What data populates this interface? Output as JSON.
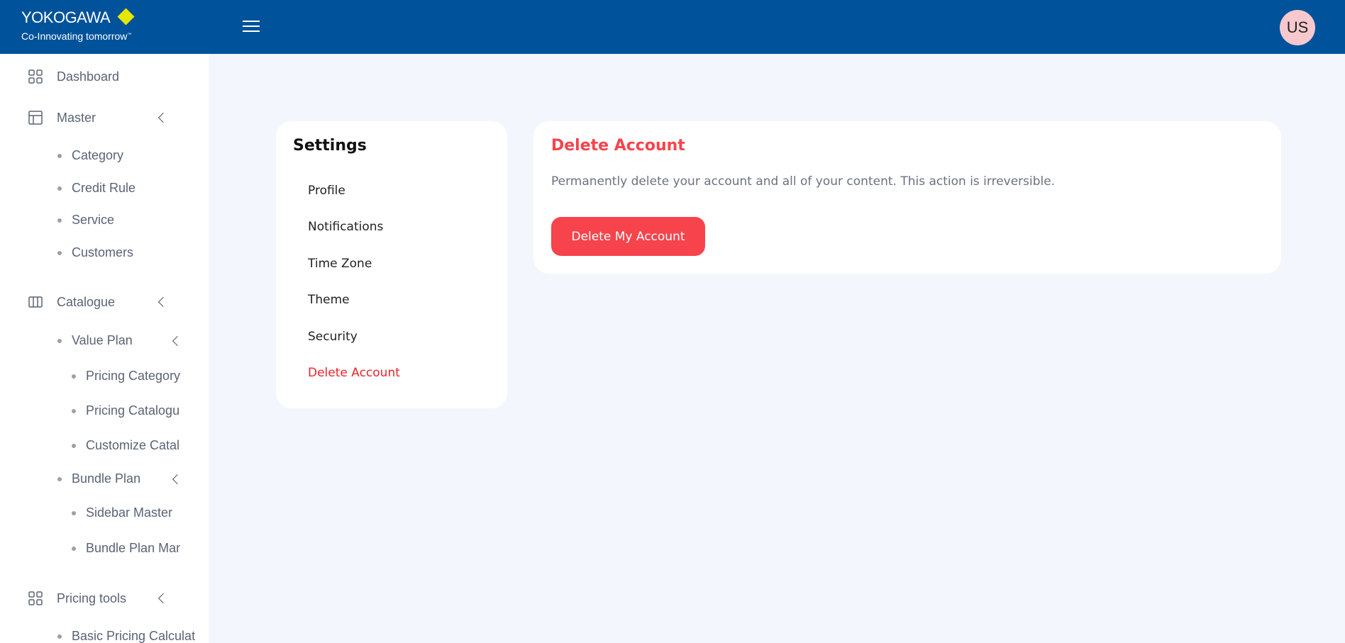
{
  "header": {
    "brand": "YOKOGAWA",
    "tagline": "Co-Innovating tomorrow",
    "tagline_mark": "™",
    "avatar": "US"
  },
  "sidebar": {
    "dashboard": "Dashboard",
    "master": "Master",
    "master_items": [
      "Category",
      "Credit Rule",
      "Service",
      "Customers"
    ],
    "catalogue": "Catalogue",
    "value_plan": "Value Plan",
    "value_plan_items": [
      "Pricing Category",
      "Pricing Catalogue",
      "Customize Catalogue"
    ],
    "bundle_plan": "Bundle Plan",
    "bundle_plan_items": [
      "Sidebar Master",
      "Bundle Plan Management"
    ],
    "pricing_tools": "Pricing tools",
    "pricing_tools_items": [
      "Basic Pricing Calculator"
    ]
  },
  "settings": {
    "title": "Settings",
    "links": [
      "Profile",
      "Notifications",
      "Time Zone",
      "Theme",
      "Security",
      "Delete Account"
    ]
  },
  "delete_account": {
    "title": "Delete Account",
    "description": "Permanently delete your account and all of your content. This action is irreversible.",
    "button": "Delete My Account"
  },
  "colors": {
    "header_bg": "#00529b",
    "accent_red": "#f7434b",
    "page_bg": "#f3f6fd",
    "logo_diamond": "#e6e600"
  }
}
